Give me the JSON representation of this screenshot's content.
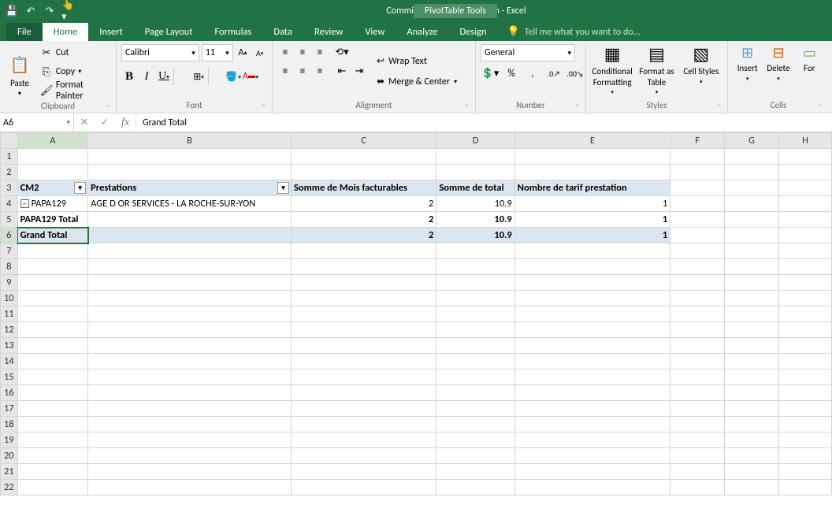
{
  "titlebar": {
    "title": "Commission Auto Facturation - Excel",
    "pivot_tools": "PivotTable Tools"
  },
  "tabs": {
    "file": "File",
    "home": "Home",
    "insert": "Insert",
    "page_layout": "Page Layout",
    "formulas": "Formulas",
    "data": "Data",
    "review": "Review",
    "view": "View",
    "analyze": "Analyze",
    "design": "Design",
    "tell_me": "Tell me what you want to do..."
  },
  "ribbon": {
    "clipboard": {
      "label": "Clipboard",
      "paste": "Paste",
      "cut": "Cut",
      "copy": "Copy",
      "fmt": "Format Painter"
    },
    "font": {
      "label": "Font",
      "name": "Calibri",
      "size": "11"
    },
    "alignment": {
      "label": "Alignment",
      "wrap": "Wrap Text",
      "merge": "Merge & Center"
    },
    "number": {
      "label": "Number",
      "format": "General"
    },
    "styles": {
      "label": "Styles",
      "cond": "Conditional Formatting",
      "table": "Format as Table",
      "cell": "Cell Styles"
    },
    "cells": {
      "label": "Cells",
      "insert": "Insert",
      "delete": "Delete",
      "format": "For"
    }
  },
  "namebox": "A6",
  "formula": "Grand Total",
  "columns": [
    "A",
    "B",
    "C",
    "D",
    "E",
    "F",
    "G",
    "H"
  ],
  "row_headers": [
    1,
    2,
    3,
    4,
    5,
    6,
    7,
    8,
    9,
    10,
    11,
    12,
    13,
    14,
    15,
    16,
    17,
    18,
    19,
    20,
    21,
    22
  ],
  "pivot": {
    "header": {
      "cm2": "CM2",
      "prest": "Prestations",
      "c": "Somme de Mois facturables",
      "d": "Somme de total",
      "e": "Nombre de tarif prestation"
    },
    "r4": {
      "a": "PAPA129",
      "b": "AGE D OR SERVICES - LA ROCHE-SUR-YON",
      "c": "2",
      "d": "10.9",
      "e": "1"
    },
    "r5": {
      "a": "PAPA129 Total",
      "c": "2",
      "d": "10.9",
      "e": "1"
    },
    "r6": {
      "a": "Grand Total",
      "c": "2",
      "d": "10.9",
      "e": "1"
    }
  }
}
